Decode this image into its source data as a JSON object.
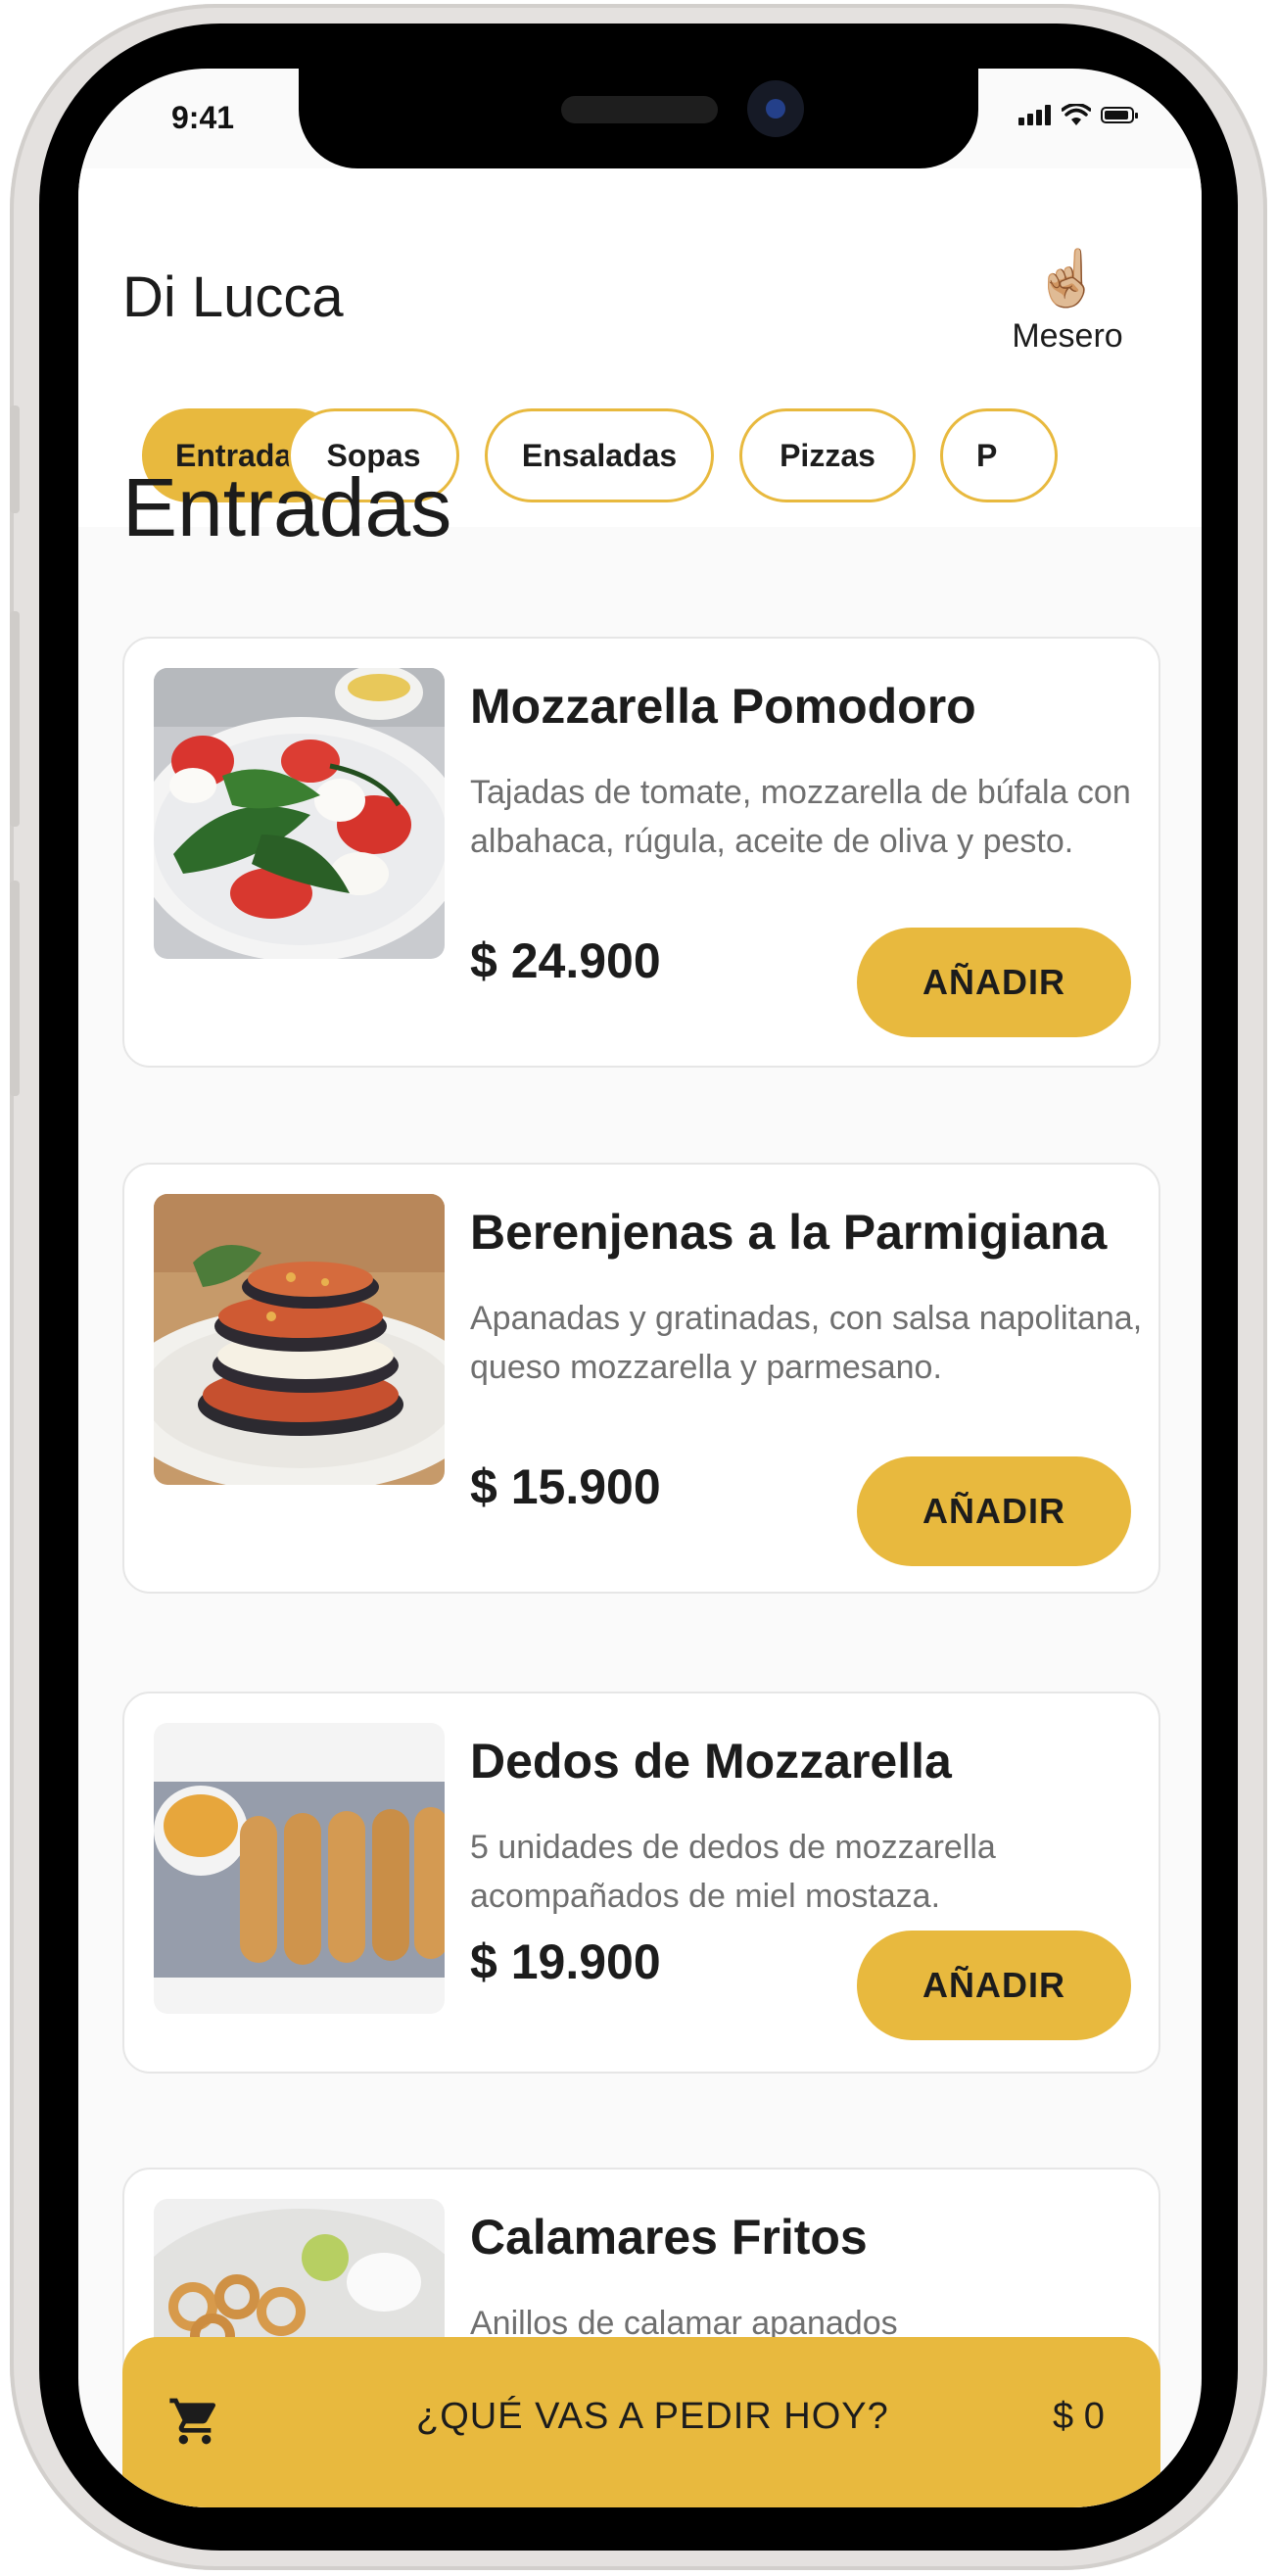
{
  "status_bar": {
    "time": "9:41"
  },
  "header": {
    "title": "Di Lucca",
    "role_icon": "☝🏼",
    "role_label": "Mesero"
  },
  "tabs": [
    {
      "label": "Entradas",
      "active": true
    },
    {
      "label": "Sopas",
      "active": false
    },
    {
      "label": "Ensaladas",
      "active": false
    },
    {
      "label": "Pizzas",
      "active": false
    },
    {
      "label": "P",
      "active": false
    }
  ],
  "section": {
    "title": "Entradas"
  },
  "items": [
    {
      "name": "Mozzarella Pomodoro",
      "description": "Tajadas de tomate, mozzarella de búfala con albahaca, rúgula, aceite de oliva y pesto.",
      "price": "$ 24.900",
      "button": "AÑADIR",
      "image_icon": "caprese-salad-photo"
    },
    {
      "name": "Berenjenas a la Parmigiana",
      "description": "Apanadas y gratinadas, con salsa napolitana, queso mozzarella y parmesano.",
      "price": "$ 15.900",
      "button": "AÑADIR",
      "image_icon": "eggplant-parmigiana-photo"
    },
    {
      "name": "Dedos de Mozzarella",
      "description": "5 unidades de dedos de mozzarella acompañados de miel mostaza.",
      "price": "$ 19.900",
      "button": "AÑADIR",
      "image_icon": "mozzarella-sticks-photo"
    },
    {
      "name": "Calamares Fritos",
      "description": "Anillos de calamar apanados",
      "image_icon": "fried-calamari-photo"
    }
  ],
  "order_bar": {
    "icon": "cart-icon",
    "label": "¿QUÉ VAS A PEDIR HOY?",
    "total": "$ 0"
  },
  "colors": {
    "accent": "#e8b93e",
    "text": "#1c1c1c",
    "muted": "#6f6f6f",
    "background": "#fafafa"
  }
}
